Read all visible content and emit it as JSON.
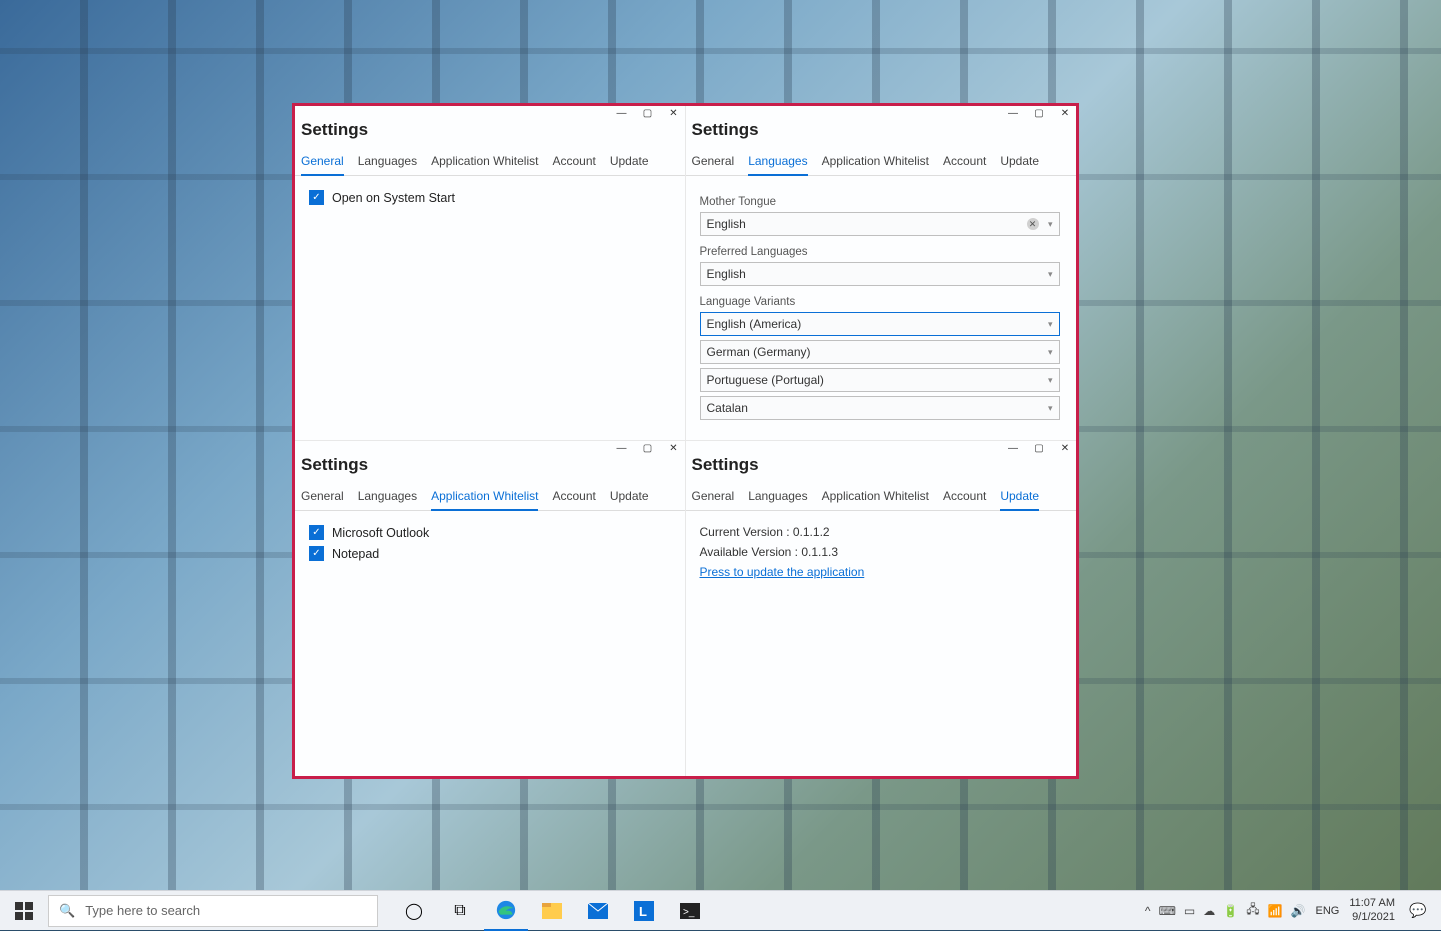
{
  "window_title": "Settings",
  "panes": {
    "general": {
      "tabs": [
        "General",
        "Languages",
        "Application Whitelist",
        "Account",
        "Update"
      ],
      "active_tab": "General",
      "option_label": "Open on System Start"
    },
    "languages": {
      "tabs": [
        "General",
        "Languages",
        "Application Whitelist",
        "Account",
        "Update"
      ],
      "active_tab": "Languages",
      "mother_tongue_label": "Mother Tongue",
      "mother_tongue_value": "English",
      "preferred_label": "Preferred Languages",
      "preferred_value": "English",
      "variants_label": "Language Variants",
      "variants": [
        "English (America)",
        "German (Germany)",
        "Portuguese (Portugal)",
        "Catalan"
      ]
    },
    "whitelist": {
      "tabs": [
        "General",
        "Languages",
        "Application Whitelist",
        "Account",
        "Update"
      ],
      "active_tab": "Application Whitelist",
      "items": [
        "Microsoft Outlook",
        "Notepad"
      ]
    },
    "update": {
      "tabs": [
        "General",
        "Languages",
        "Application Whitelist",
        "Account",
        "Update"
      ],
      "active_tab": "Update",
      "current_label": "Current Version : 0.1.1.2",
      "available_label": "Available Version : 0.1.1.3",
      "link_text": "Press to update the application"
    }
  },
  "taskbar": {
    "search_placeholder": "Type here to search",
    "lang": "ENG",
    "time": "11:07 AM",
    "date": "9/1/2021"
  }
}
